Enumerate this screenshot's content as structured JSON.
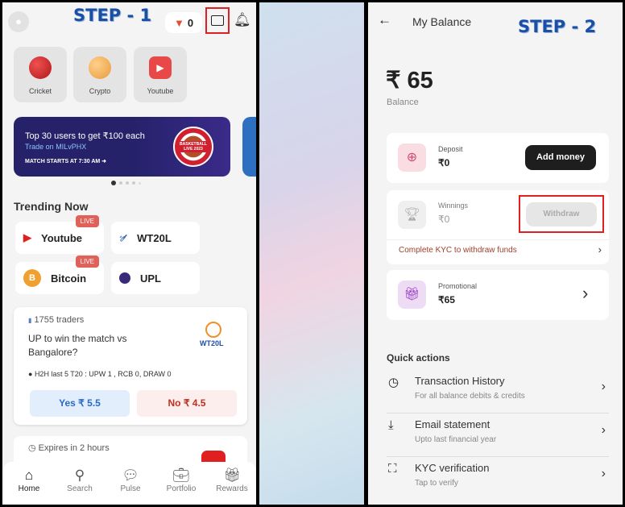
{
  "step1": {
    "label": "STEP - 1"
  },
  "step2": {
    "label": "STEP - 2"
  },
  "home": {
    "header": {
      "coins": "0"
    },
    "categories": [
      {
        "label": "Cricket"
      },
      {
        "label": "Crypto"
      },
      {
        "label": "Youtube"
      }
    ],
    "banner": {
      "title": "Top 30 users to get ₹100 each",
      "subtitle": "Trade on MILvPHX",
      "time": "MATCH STARTS AT 7:30 AM",
      "badge_text": "BASKETBALL LIVE 2023"
    },
    "trending": {
      "title": "Trending Now",
      "live_label": "LIVE",
      "chips": [
        {
          "label": "Youtube",
          "live": true
        },
        {
          "label": "WT20L",
          "live": false
        },
        {
          "label": "Bitcoin",
          "live": true
        },
        {
          "label": "UPL",
          "live": false
        }
      ]
    },
    "event_card": {
      "traders": "1755 traders",
      "question": "UP to win the match vs Bangalore?",
      "logo": "WT20L",
      "info": "H2H last 5 T20 : UPW 1 ,  RCB 0, DRAW 0",
      "yes": "Yes ₹ 5.5",
      "no": "No ₹ 4.5"
    },
    "event_card2": {
      "expires": "Expires in 2 hours"
    },
    "nav": [
      {
        "label": "Home",
        "icon": "home-icon"
      },
      {
        "label": "Search",
        "icon": "search-icon"
      },
      {
        "label": "Pulse",
        "icon": "pulse-icon"
      },
      {
        "label": "Portfolio",
        "icon": "portfolio-icon"
      },
      {
        "label": "Rewards",
        "icon": "gift-icon"
      }
    ]
  },
  "balance": {
    "title": "My Balance",
    "amount": "₹ 65",
    "amount_label": "Balance",
    "deposit": {
      "label": "Deposit",
      "value": "₹0",
      "button": "Add money"
    },
    "winnings": {
      "label": "Winnings",
      "value": "₹0",
      "button": "Withdraw",
      "kyc": "Complete KYC to withdraw funds"
    },
    "promotional": {
      "label": "Promotional",
      "value": "₹65"
    },
    "quick_title": "Quick actions",
    "quick": [
      {
        "title": "Transaction History",
        "subtitle": "For all balance debits & credits"
      },
      {
        "title": "Email statement",
        "subtitle": "Upto last financial year"
      },
      {
        "title": "KYC verification",
        "subtitle": "Tap to verify"
      }
    ]
  },
  "colors": {
    "highlight": "#e02020",
    "step": "#1a4fa8",
    "kyc": "#a0402c"
  }
}
